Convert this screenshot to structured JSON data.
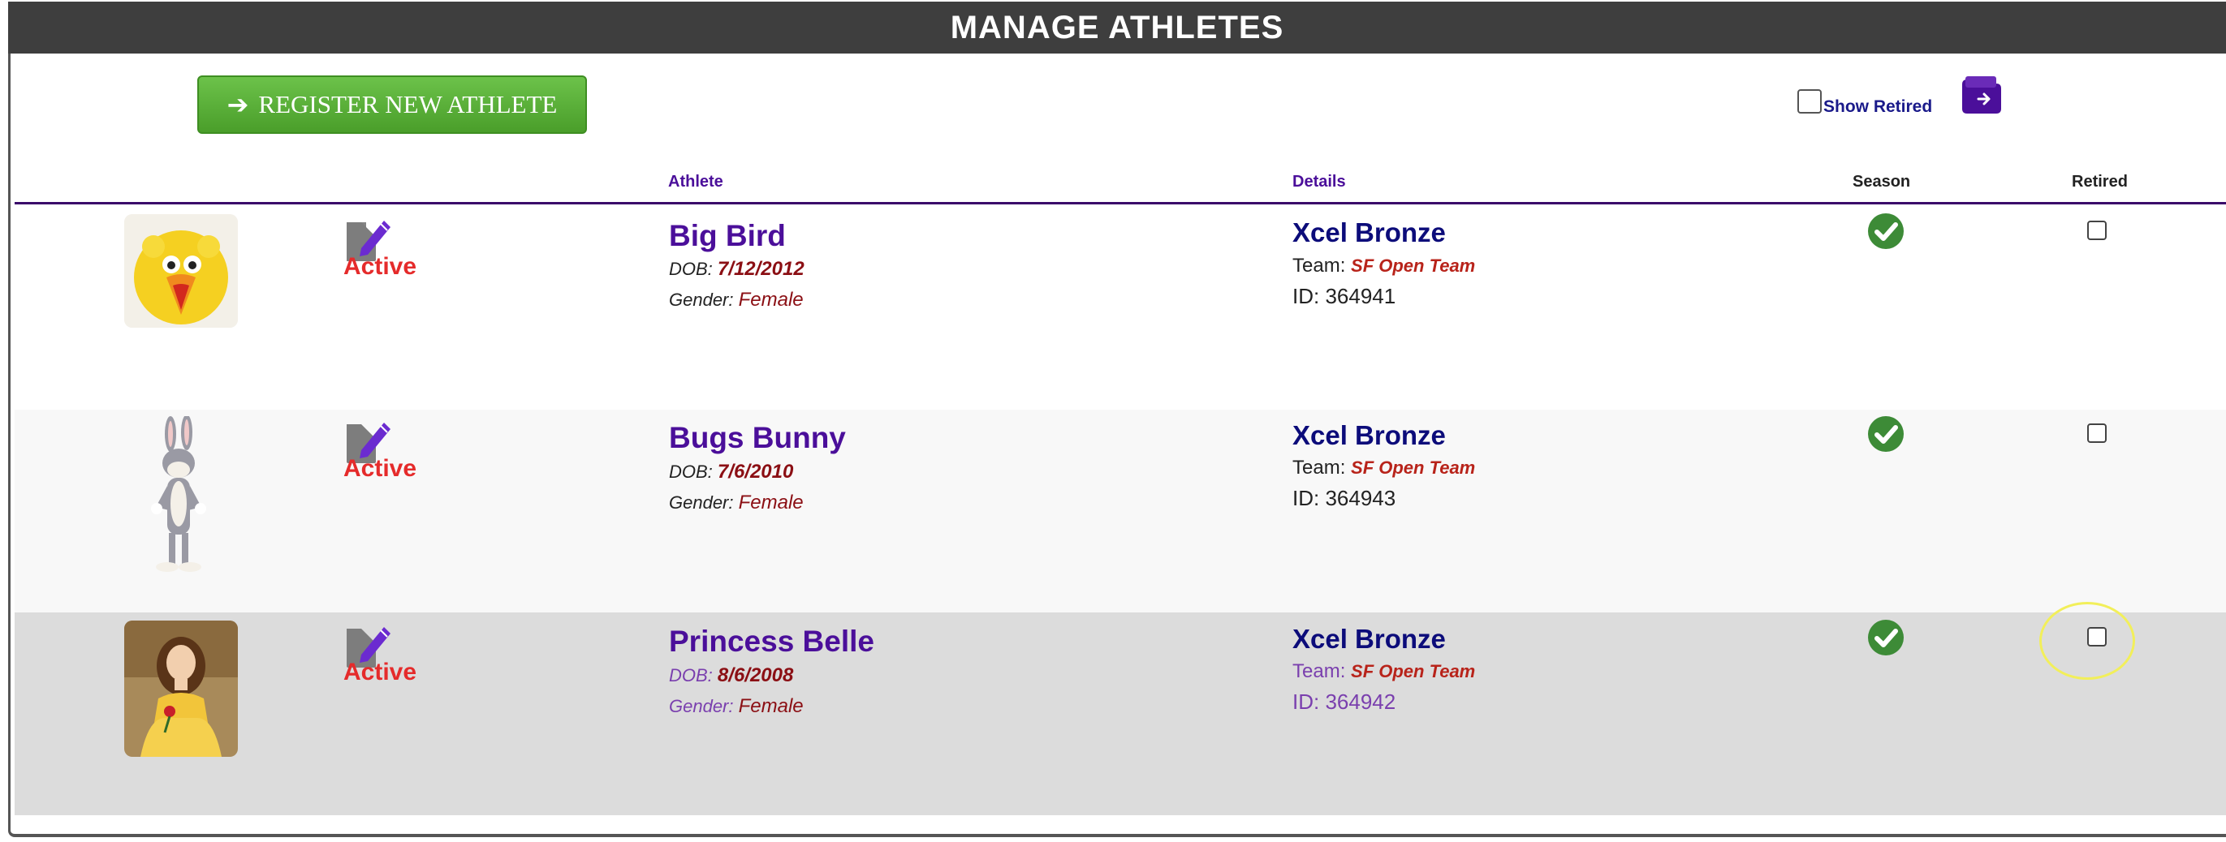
{
  "header": {
    "title": "MANAGE ATHLETES"
  },
  "toolbar": {
    "register_arrow": "➔",
    "register_label": "REGISTER NEW ATHLETE",
    "show_retired_label": "Show Retired",
    "folder_icon": "folder-export-icon"
  },
  "columns": {
    "athlete": "Athlete",
    "details": "Details",
    "season": "Season",
    "retired": "Retired"
  },
  "labels": {
    "dob": "DOB:",
    "gender": "Gender:",
    "team": "Team:",
    "id": "ID:"
  },
  "athletes": [
    {
      "name": "Big Bird",
      "status": "Active",
      "dob": "7/12/2012",
      "gender": "Female",
      "level": "Xcel Bronze",
      "team": "SF Open Team",
      "id": "364941",
      "season_active": true,
      "retired": false,
      "avatar": "big-bird"
    },
    {
      "name": "Bugs Bunny",
      "status": "Active",
      "dob": "7/6/2010",
      "gender": "Female",
      "level": "Xcel Bronze",
      "team": "SF Open Team",
      "id": "364943",
      "season_active": true,
      "retired": false,
      "avatar": "bugs-bunny"
    },
    {
      "name": "Princess Belle",
      "status": "Active",
      "dob": "8/6/2008",
      "gender": "Female",
      "level": "Xcel Bronze",
      "team": "SF Open Team",
      "id": "364942",
      "season_active": true,
      "retired": false,
      "avatar": "princess-belle"
    }
  ],
  "colors": {
    "header_bg": "#3e3e3e",
    "accent_purple": "#4b0f9a",
    "button_green": "#5bb13a",
    "status_red": "#e52b2b",
    "check_green": "#3d8b37"
  }
}
